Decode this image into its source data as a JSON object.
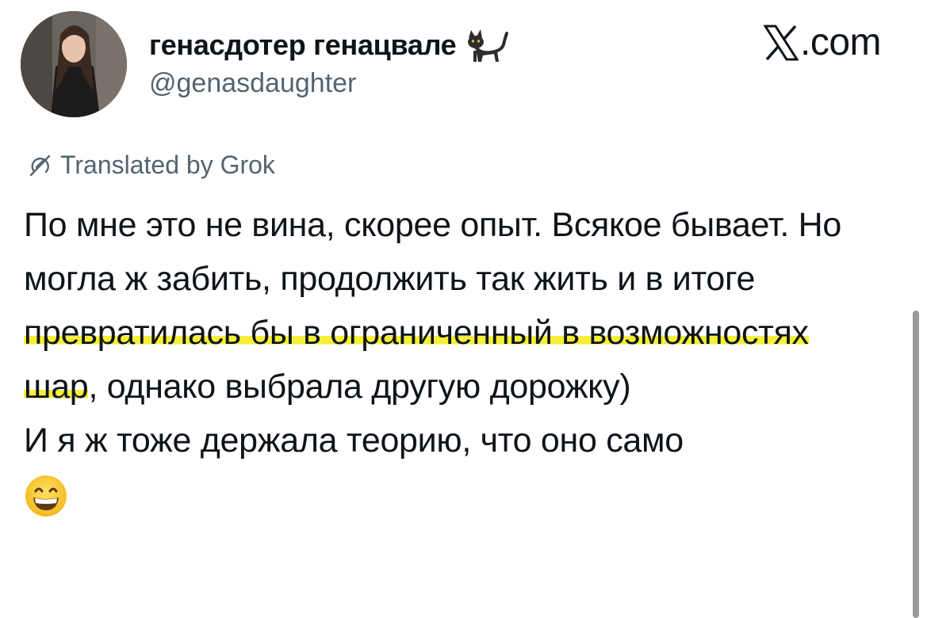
{
  "author": {
    "display_name": "генасдотер генацвале",
    "display_name_emoji": "cat-icon",
    "handle": "@genasdaughter",
    "avatar": "profile-photo"
  },
  "brand": {
    "logo": "x-logo-icon",
    "text": ".com"
  },
  "translation": {
    "icon": "grok-icon",
    "label": "Translated by Grok"
  },
  "tweet": {
    "paragraph1_before_highlight": "По мне это не вина, скорее опыт. Всякое бывает. Но могла ж забить, продолжить так жить и в итоге ",
    "highlight": "превратилась бы в ограниченный в возможностях шар",
    "paragraph1_after_highlight": ", однако выбрала другую дорожку)",
    "paragraph2": "И я ж тоже держала теорию, что оно само",
    "trailing_emoji": "grinning-face-emoji",
    "highlight_color": "#f5ef3a"
  },
  "colors": {
    "text_primary": "#0f1419",
    "text_secondary": "#536471"
  }
}
